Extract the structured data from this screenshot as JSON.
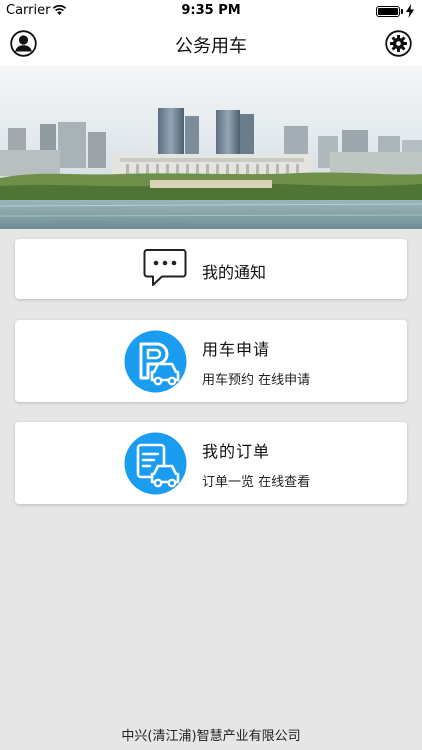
{
  "status_bar": {
    "carrier": "Carrier",
    "time": "9:35 PM"
  },
  "nav": {
    "title": "公务用车",
    "left_icon": "profile-icon",
    "right_icon": "settings-icon"
  },
  "banner": {
    "image": "city-skyline-photo"
  },
  "cards": {
    "notice": {
      "label": "我的通知",
      "icon": "chat-bubble-icon"
    },
    "apply": {
      "label": "用车申请",
      "sub": "用车预约 在线申请",
      "icon": "parking-car-icon"
    },
    "orders": {
      "label": "我的订单",
      "sub": "订单一览 在线查看",
      "icon": "document-car-icon"
    }
  },
  "footer": {
    "company": "中兴(清江浦)智慧产业有限公司"
  },
  "colors": {
    "accent_blue": "#1a9cf0",
    "background": "#e6e6e6",
    "card": "#ffffff"
  }
}
